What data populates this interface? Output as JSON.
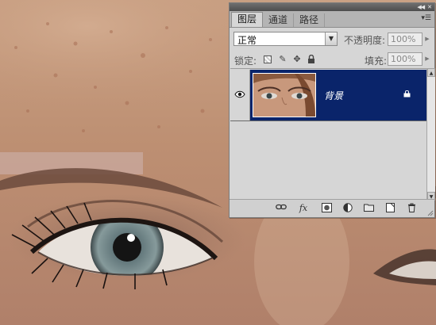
{
  "panel": {
    "tabs": [
      {
        "label": "图层",
        "active": true
      },
      {
        "label": "通道",
        "active": false
      },
      {
        "label": "路径",
        "active": false
      }
    ],
    "collapse_icon": "double-chevron-right-icon",
    "menu_icon": "panel-menu-icon",
    "blend_mode": "正常",
    "opacity_label": "不透明度:",
    "opacity_value": "100%",
    "lock_label": "锁定:",
    "fill_label": "填充:",
    "fill_value": "100%",
    "layers": [
      {
        "name": "背景",
        "visible": true,
        "selected": true,
        "locked": true
      }
    ],
    "bottom_icons": [
      "link-layers-icon",
      "fx-icon",
      "layer-mask-icon",
      "adjustment-layer-icon",
      "new-group-icon",
      "new-layer-icon",
      "delete-layer-icon"
    ],
    "fx_label": "fx",
    "colors": {
      "panel_bg": "#d6d6d6",
      "selected_row": "#0a246a",
      "titlebar": "#5a5a5a"
    }
  }
}
